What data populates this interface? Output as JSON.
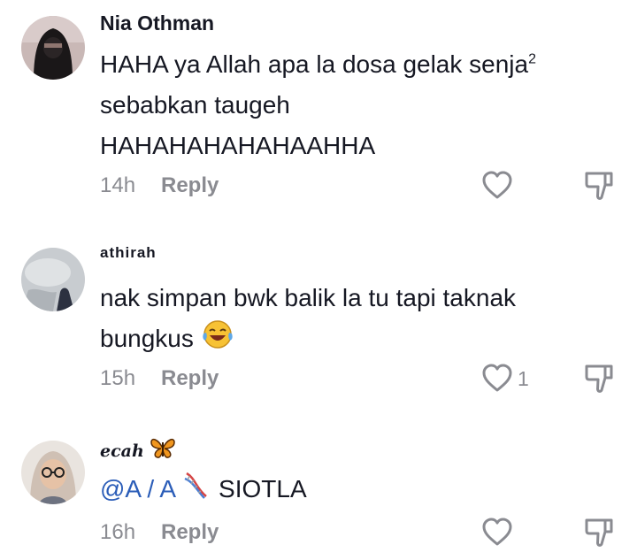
{
  "comments": [
    {
      "username": "Nia Othman",
      "lines": [
        "HAHA ya Allah apa la dosa gelak senja",
        "sebabkan taugeh",
        "HAHAHAHAHAHAAHHA"
      ],
      "superscript": "2",
      "time": "14h",
      "reply_label": "Reply",
      "like_count": ""
    },
    {
      "username": "athirah",
      "lines": [
        "nak simpan bwk balik la tu tapi taknak",
        "bungkus"
      ],
      "time": "15h",
      "reply_label": "Reply",
      "like_count": "1",
      "emoji": "face-with-tears-of-joy"
    },
    {
      "username": "ecah",
      "username_emoji": "butterfly",
      "mention": "@A / A",
      "mention_emoji": "dna",
      "text": "SIOTLA",
      "time": "16h",
      "reply_label": "Reply",
      "like_count": ""
    }
  ],
  "colors": {
    "text": "#161823",
    "secondary": "#8a8b91",
    "mention": "#2b5db8",
    "background": "#ffffff"
  }
}
